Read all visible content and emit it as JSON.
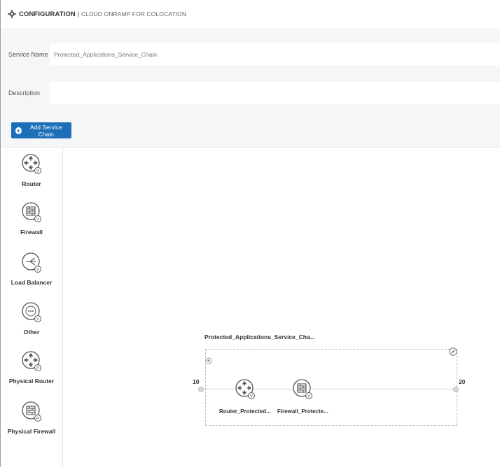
{
  "header": {
    "title": "CONFIGURATION",
    "subtitle": "CLOUD ONRAMP FOR COLOCATION",
    "icon": "gear-icon"
  },
  "form": {
    "service_name_label": "Service Name",
    "service_name_value": "Protected_Applications_Service_Chain",
    "description_label": "Description",
    "description_value": ""
  },
  "toolbar": {
    "add_label": "Add Service Chain",
    "accent": "#1d6fb8"
  },
  "palette": {
    "items": [
      {
        "label": "Router",
        "icon": "router-icon"
      },
      {
        "label": "Firewall",
        "icon": "firewall-icon"
      },
      {
        "label": "Load Balancer",
        "icon": "load-balancer-icon"
      },
      {
        "label": "Other",
        "icon": "other-icon"
      },
      {
        "label": "Physical Router",
        "icon": "physical-router-icon"
      },
      {
        "label": "Physical Firewall",
        "icon": "physical-firewall-icon"
      }
    ]
  },
  "chain": {
    "name": "Protected_Applications_Service_Cha...",
    "left_vlan": "10",
    "right_vlan": "20",
    "nodes": [
      {
        "label": "Router_Protected...",
        "icon": "router-icon"
      },
      {
        "label": "Firewall_Protecte...",
        "icon": "firewall-icon"
      }
    ]
  }
}
